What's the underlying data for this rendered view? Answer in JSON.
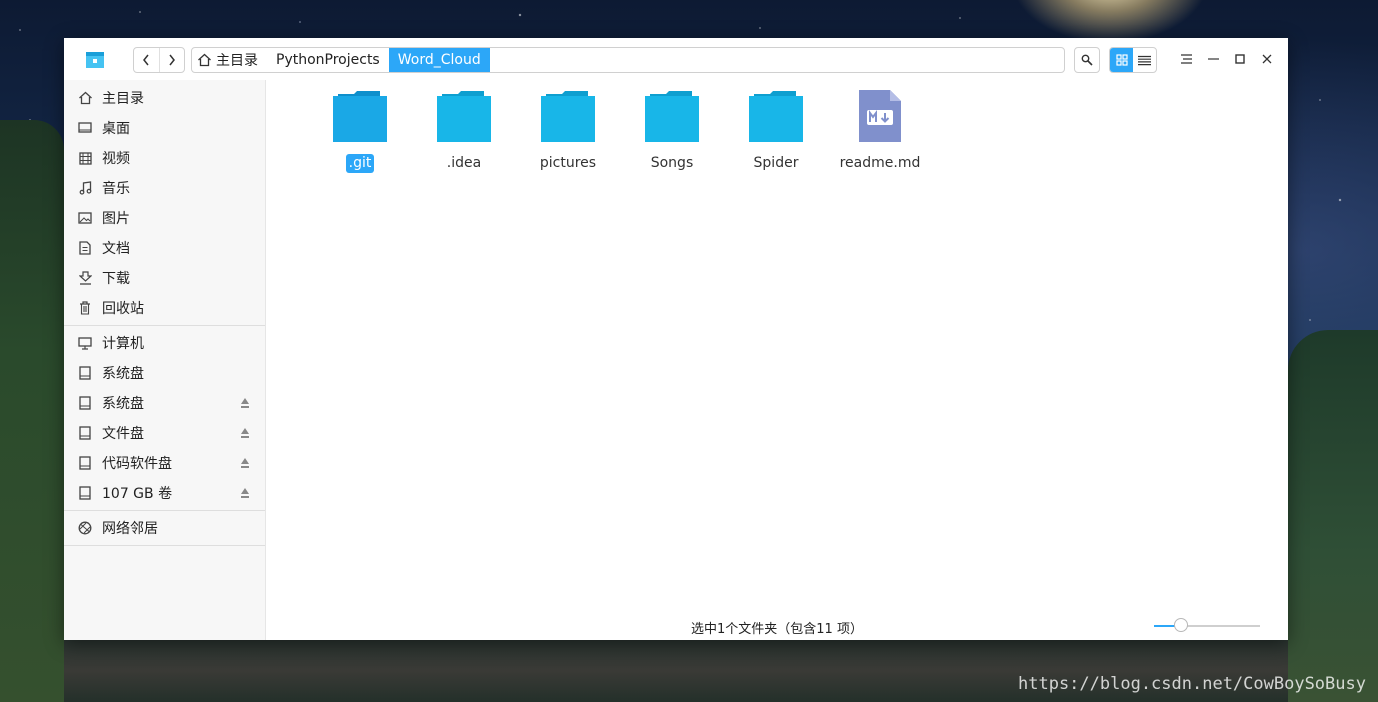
{
  "desktop": {
    "watermark": "https://blog.csdn.net/CowBoySoBusy"
  },
  "breadcrumb": [
    "主目录",
    "PythonProjects",
    "Word_Cloud"
  ],
  "sidebar": {
    "places": [
      {
        "label": "主目录",
        "icon": "home-icon"
      },
      {
        "label": "桌面",
        "icon": "desktop-icon"
      },
      {
        "label": "视频",
        "icon": "video-icon"
      },
      {
        "label": "音乐",
        "icon": "music-icon"
      },
      {
        "label": "图片",
        "icon": "picture-icon"
      },
      {
        "label": "文档",
        "icon": "document-icon"
      },
      {
        "label": "下载",
        "icon": "download-icon"
      },
      {
        "label": "回收站",
        "icon": "trash-icon"
      }
    ],
    "devices": [
      {
        "label": "计算机",
        "icon": "computer-icon"
      },
      {
        "label": "系统盘",
        "icon": "disk-icon"
      },
      {
        "label": "系统盘",
        "icon": "disk-icon"
      },
      {
        "label": "文件盘",
        "icon": "disk-icon"
      },
      {
        "label": "代码软件盘",
        "icon": "disk-icon"
      },
      {
        "label": "107 GB 卷",
        "icon": "disk-icon"
      }
    ],
    "network": [
      {
        "label": "网络邻居",
        "icon": "network-icon"
      }
    ]
  },
  "files": [
    {
      "name": ".git",
      "type": "folder",
      "selected": true
    },
    {
      "name": ".idea",
      "type": "folder"
    },
    {
      "name": "pictures",
      "type": "folder"
    },
    {
      "name": "Songs",
      "type": "folder"
    },
    {
      "name": "Spider",
      "type": "folder"
    },
    {
      "name": "readme.md",
      "type": "markdown"
    }
  ],
  "status": "选中1个文件夹（包含11 项）",
  "zoom_level_fraction": 0.25,
  "colors": {
    "accent": "#2ca7f8",
    "folder": "#1ab0e8",
    "markdown": "#8090cc"
  }
}
